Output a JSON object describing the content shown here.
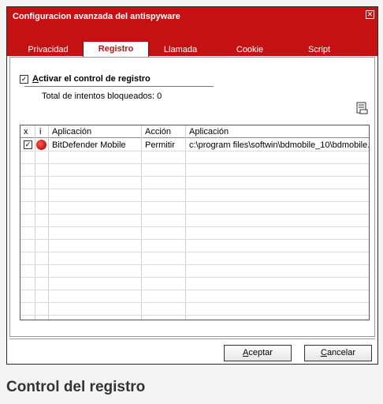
{
  "window": {
    "title": "Configuracion avanzada del antispyware",
    "close_glyph": "✕"
  },
  "tabs": [
    {
      "label": "Privacidad"
    },
    {
      "label": "Registro"
    },
    {
      "label": "Llamada"
    },
    {
      "label": "Cookie"
    },
    {
      "label": "Script"
    }
  ],
  "activate": {
    "label": "Activar el control de registro",
    "checked": true
  },
  "total": {
    "text": "Total de intentos bloqueados: 0"
  },
  "grid": {
    "headers": {
      "x": "x",
      "i": "i",
      "app": "Aplicación",
      "action": "Acción",
      "path": "Aplicación"
    },
    "rows": [
      {
        "checked": true,
        "app": "BitDefender Mobile",
        "action": "Permitir",
        "path": "c:\\program files\\softwin\\bdmobile_10\\bdmobile..."
      }
    ]
  },
  "buttons": {
    "accept_first": "A",
    "accept_rest": "ceptar",
    "cancel_first": "C",
    "cancel_rest": "ancelar"
  },
  "caption": "Control del registro",
  "colors": {
    "title_bar": "#c41214",
    "active_tab_text": "#c41214"
  },
  "icons": {
    "close": "close-icon",
    "export": "export-icon",
    "app": "bitdefender-icon"
  }
}
